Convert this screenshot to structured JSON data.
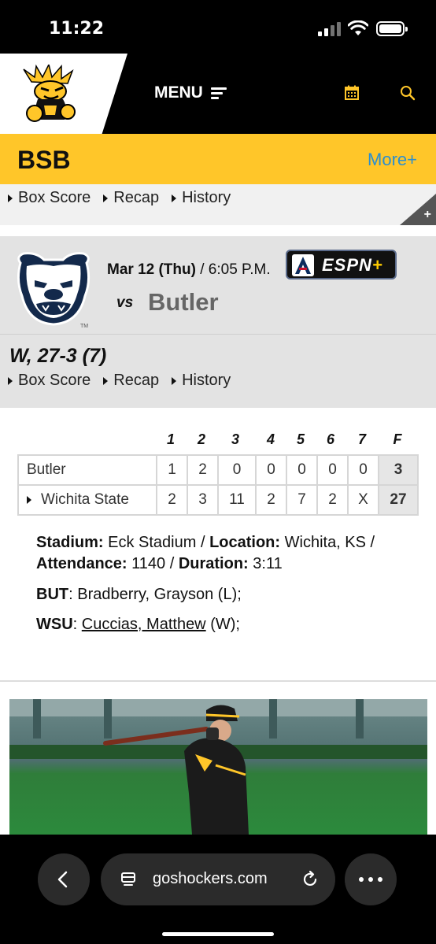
{
  "status_bar": {
    "time": "11:22"
  },
  "header": {
    "menu_label": "MENU"
  },
  "section": {
    "title": "BSB",
    "more_label": "More+"
  },
  "prev_game": {
    "links": [
      "Box Score",
      "Recap",
      "History"
    ],
    "expand_label": "+"
  },
  "game": {
    "date": "Mar 12 (Thu)",
    "time": " / 6:05 P.M.",
    "broadcast": "ESPN",
    "broadcast_plus": "+",
    "vs_label": "vs",
    "opponent": "Butler",
    "result": "W, 27-3 (7)",
    "links": [
      "Box Score",
      "Recap",
      "History"
    ]
  },
  "linescore": {
    "headers": [
      "1",
      "2",
      "3",
      "4",
      "5",
      "6",
      "7",
      "F"
    ],
    "rows": [
      {
        "team": "Butler",
        "innings": [
          "1",
          "2",
          "0",
          "0",
          "0",
          "0",
          "0"
        ],
        "final": "3"
      },
      {
        "team": "Wichita State",
        "innings": [
          "2",
          "3",
          "11",
          "2",
          "7",
          "2",
          "X"
        ],
        "final": "27"
      }
    ]
  },
  "details": {
    "stadium_label": "Stadium:",
    "stadium": " Eck Stadium / ",
    "location_label": "Location:",
    "location": " Wichita, KS / ",
    "attendance_label": "Attendance:",
    "attendance": " 1140 / ",
    "duration_label": "Duration:",
    "duration": " 3:11",
    "but_label": "BUT",
    "but_text": ": Bradberry, Grayson (L);",
    "wsu_label": "WSU",
    "wsu_sep": ": ",
    "wsu_player": "Cuccias, Matthew",
    "wsu_decision": " (W);"
  },
  "browser": {
    "url": "goshockers.com"
  },
  "colors": {
    "gold": "#ffc629",
    "link_blue": "#2a8fd0",
    "black": "#000000"
  }
}
